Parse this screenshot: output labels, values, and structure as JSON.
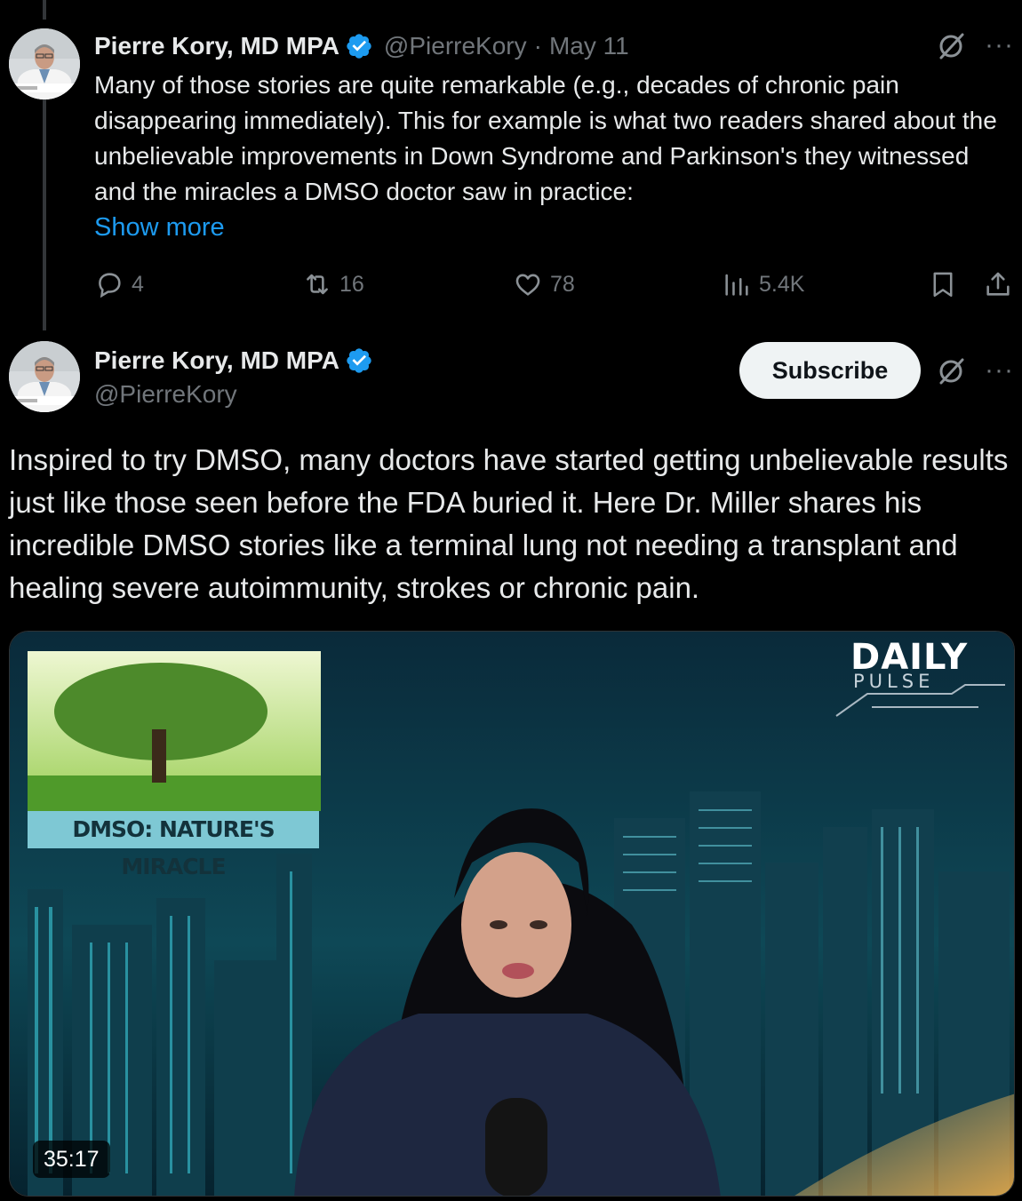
{
  "tweet1": {
    "author_name": "Pierre Kory, MD MPA",
    "handle": "@PierreKory",
    "separator": "·",
    "date": "May 11",
    "body": "Many of those stories are quite remarkable (e.g., decades of chronic pain disappearing immediately).  This for example is what two readers shared about the unbelievable improvements in Down Syndrome and Parkinson's they witnessed and the miracles a DMSO doctor saw in practice:",
    "show_more": "Show more",
    "more_label": "···",
    "stats": {
      "replies": "4",
      "reposts": "16",
      "likes": "78",
      "views": "5.4K"
    }
  },
  "tweet2": {
    "author_name": "Pierre Kory, MD MPA",
    "handle": "@PierreKory",
    "subscribe_label": "Subscribe",
    "more_label": "···",
    "body": "Inspired to try DMSO, many doctors have started getting unbelievable results just like those seen before the FDA buried it. Here Dr. Miller shares his incredible DMSO stories like a terminal lung not needing a transplant and healing severe autoimmunity, strokes or chronic pain.",
    "video": {
      "duration": "35:17",
      "inset_caption": "DMSO: NATURE'S MIRACLE",
      "brand_line1": "DAILY",
      "brand_line2": "PULSE"
    }
  },
  "colors": {
    "background": "#000000",
    "text": "#e7e9ea",
    "muted": "#71767b",
    "link": "#1d9bf0",
    "verified": "#1d9bf0",
    "button_bg": "#eff3f4"
  },
  "icons": [
    "verified-badge-icon",
    "grok-icon",
    "more-icon",
    "reply-icon",
    "repost-icon",
    "like-icon",
    "views-icon",
    "bookmark-icon",
    "share-icon"
  ]
}
